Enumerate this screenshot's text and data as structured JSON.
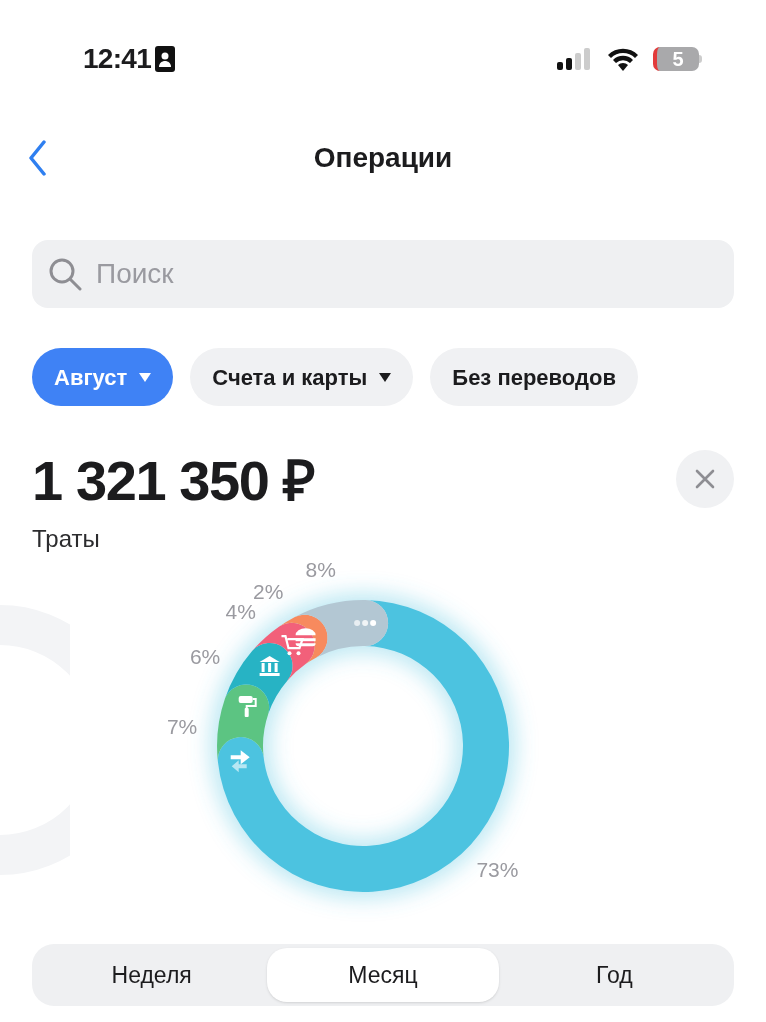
{
  "status_bar": {
    "time": "12:41",
    "battery": "5"
  },
  "header": {
    "title": "Операции"
  },
  "search": {
    "placeholder": "Поиск"
  },
  "filters": [
    {
      "label": "Август",
      "dropdown": true,
      "selected": true
    },
    {
      "label": "Счета и карты",
      "dropdown": true,
      "selected": false
    },
    {
      "label": "Без переводов",
      "dropdown": false,
      "selected": false
    }
  ],
  "summary": {
    "amount": "1 321 350 ₽",
    "caption": "Траты"
  },
  "donut": {
    "segments": [
      {
        "kind": "transfer",
        "color": "#4cc3e0"
      },
      {
        "kind": "repair",
        "color": "#5cc482"
      },
      {
        "kind": "bank",
        "color": "#27b3c4"
      },
      {
        "kind": "shopping",
        "color": "#f2607a"
      },
      {
        "kind": "food",
        "color": "#f78a5e"
      },
      {
        "kind": "other",
        "color": "#b3c7d3"
      }
    ],
    "chart_data": {
      "type": "donut",
      "values": [
        73,
        7,
        6,
        4,
        2,
        8
      ],
      "value_labels": [
        "73%",
        "7%",
        "6%",
        "4%",
        "2%",
        "8%"
      ]
    }
  },
  "periods": [
    {
      "label": "Неделя",
      "selected": false
    },
    {
      "label": "Месяц",
      "selected": true
    },
    {
      "label": "Год",
      "selected": false
    }
  ]
}
